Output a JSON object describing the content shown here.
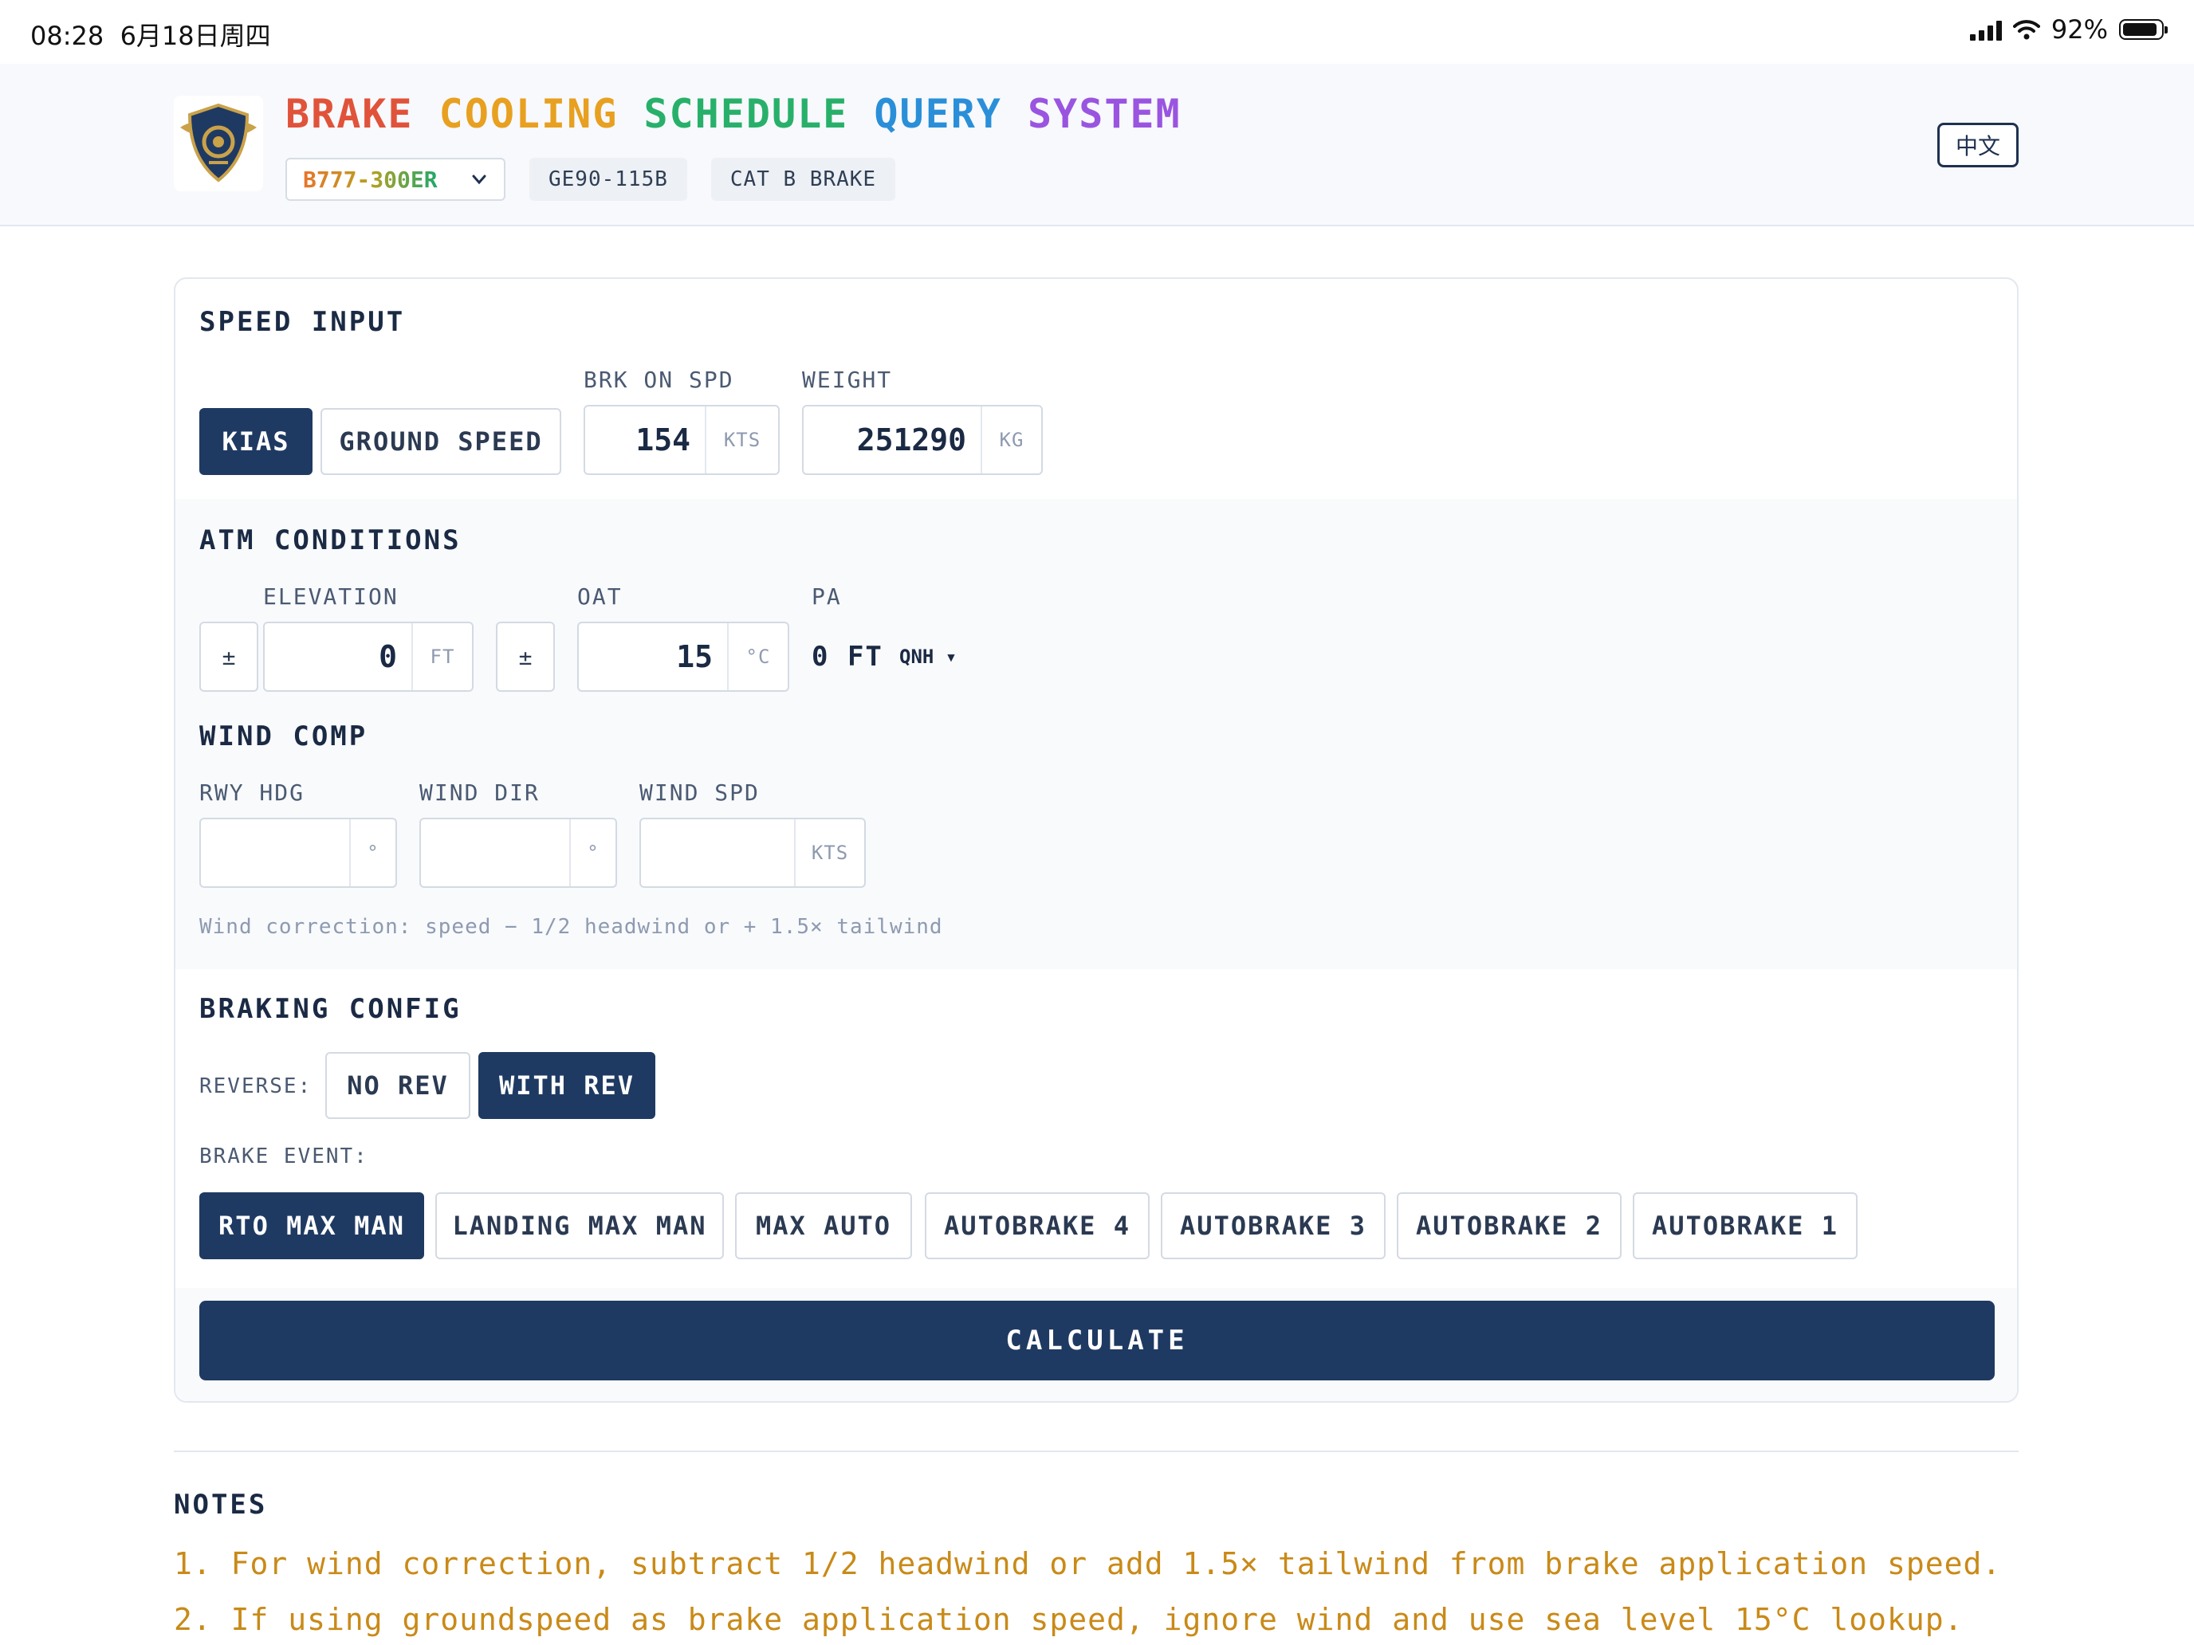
{
  "status_bar": {
    "time": "08:28",
    "date": "6月18日周四",
    "battery": "92%",
    "battery_fraction": 0.92
  },
  "header": {
    "title_words": [
      {
        "text": "BRAKE",
        "color": "#e0533a"
      },
      {
        "text": "COOLING",
        "color": "#e8a020"
      },
      {
        "text": "SCHEDULE",
        "color": "#28b06a"
      },
      {
        "text": "QUERY",
        "color": "#2a8fd8"
      },
      {
        "text": "SYSTEM",
        "color": "#9a55e0"
      }
    ],
    "aircraft_model": "B777-300ER",
    "engine_tag": "GE90-115B",
    "brake_tag": "CAT B BRAKE",
    "lang_button": "中文",
    "logo_icon": "winged-shield-wheel-icon"
  },
  "speed_input": {
    "title": "SPEED INPUT",
    "modes": [
      "KIAS",
      "GROUND SPEED"
    ],
    "active_mode": "KIAS",
    "brk_on_spd": {
      "label": "BRK ON SPD",
      "value": "154",
      "unit": "KTS"
    },
    "weight": {
      "label": "WEIGHT",
      "value": "251290",
      "unit": "KG"
    }
  },
  "atm_conditions": {
    "title": "ATM CONDITIONS",
    "elevation": {
      "label": "ELEVATION",
      "sign": "±",
      "value": "0",
      "unit": "FT"
    },
    "oat": {
      "label": "OAT",
      "sign": "±",
      "value": "15",
      "unit": "°C"
    },
    "pa": {
      "label": "PA",
      "value": "0 FT",
      "qnh_label": "QNH ▾"
    }
  },
  "wind_comp": {
    "title": "WIND COMP",
    "rwy_hdg": {
      "label": "RWY HDG",
      "value": "",
      "unit": "°"
    },
    "wind_dir": {
      "label": "WIND DIR",
      "value": "",
      "unit": "°"
    },
    "wind_spd": {
      "label": "WIND SPD",
      "value": "",
      "unit": "KTS"
    },
    "hint": "Wind correction: speed − 1/2 headwind or + 1.5× tailwind"
  },
  "braking_config": {
    "title": "BRAKING CONFIG",
    "reverse_label": "REVERSE:",
    "reverse_options": [
      "NO REV",
      "WITH REV"
    ],
    "active_reverse": "WITH REV",
    "event_label": "BRAKE EVENT:",
    "events": [
      "RTO MAX MAN",
      "LANDING MAX MAN",
      "MAX AUTO",
      "AUTOBRAKE 4",
      "AUTOBRAKE 3",
      "AUTOBRAKE 2",
      "AUTOBRAKE 1"
    ],
    "active_event": "RTO MAX MAN"
  },
  "calculate_label": "CALCULATE",
  "notes": {
    "title": "NOTES",
    "items": [
      "1. For wind correction, subtract 1/2 headwind or add 1.5× tailwind from brake application speed.",
      "2. If using groundspeed as brake application speed, ignore wind and use sea level 15°C lookup."
    ]
  }
}
